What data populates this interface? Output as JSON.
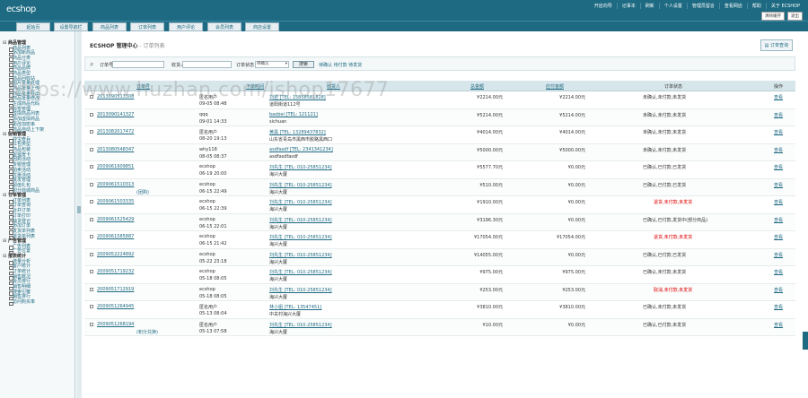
{
  "app": {
    "logo": "ecshop"
  },
  "top": {
    "links": [
      "开店向导",
      "记事本",
      "刷新",
      "个人设置",
      "管理员留言",
      "查看网店",
      "帮助",
      "关于 ECSHOP"
    ],
    "buttons": [
      "清除缓存",
      "退出"
    ]
  },
  "tabs": [
    "起始页",
    "设置导航栏",
    "商品列表",
    "订单列表",
    "用户评论",
    "会员列表",
    "商店设置"
  ],
  "sidebar": [
    {
      "group": "商品管理",
      "items": [
        "商品列表",
        "添加新商品",
        "商品分类",
        "用户评论",
        "商品品牌",
        "商品类型",
        "商品回收站",
        "图片批量处理",
        "商品批量上传",
        "商品批量导出",
        "商品批量修改",
        "生成商品代码",
        "标签管理",
        "虚拟商品列表",
        "添加虚拟商品",
        "更改加密串",
        "商品自动上下架"
      ]
    },
    {
      "group": "促销管理",
      "items": [
        "夺宝奇兵",
        "红包类型",
        "商品包装",
        "祝福贺卡",
        "团购活动",
        "专题管理",
        "拍卖活动",
        "优惠活动",
        "批发管理",
        "超值礼包",
        "积分商城商品"
      ]
    },
    {
      "group": "订单管理",
      "items": [
        "订单列表",
        "订单查询",
        "合并订单",
        "订单打印",
        "缺货登记",
        "添加订单",
        "发货单列表",
        "退货单列表"
      ]
    },
    {
      "group": "广告管理",
      "items": [
        "广告列表",
        "广告位置"
      ]
    },
    {
      "group": "报表统计",
      "items": [
        "流量分析",
        "客户统计",
        "订单统计",
        "销售概况",
        "会员排行",
        "销售明细",
        "搜索引擎",
        "销售排行",
        "访问购买率"
      ]
    }
  ],
  "page": {
    "title": "ECSHOP 管理中心",
    "subtitle": " - 订单列表",
    "query_button": "订单查询"
  },
  "search": {
    "sn_label": "订单号",
    "consignee_label": "收货人",
    "status_label": "订单状态",
    "status_value": "待确认",
    "button": "搜索",
    "quick_links": "待确认 待付款 待发货"
  },
  "table": {
    "headers": {
      "sn": "订单号",
      "time": "下单时间",
      "consignee": "收货人",
      "amount": "总金额",
      "payable": "应付金额",
      "status": "订单状态",
      "action": "操作"
    },
    "rows": [
      {
        "sn": "2013090513308",
        "buyer": "匿名用户",
        "time": "09-05 08:48",
        "consignee": "刘岩 [TEL: 15858581828]",
        "address": "道阳街道112号",
        "amount": "¥2214.00元",
        "payable": "¥2214.00元",
        "status": "未确认,未付款,未发货",
        "action": "查看",
        "tag": ""
      },
      {
        "sn": "2013090141327",
        "buyer": "qqq",
        "time": "09-01 14:33",
        "consignee": "baobei [TEL: 121121]",
        "address": "sichuan",
        "amount": "¥5214.00元",
        "payable": "¥5214.00元",
        "status": "未确认,未付款,未发货",
        "action": "查看",
        "tag": ""
      },
      {
        "sn": "2013082017472",
        "buyer": "匿名用户",
        "time": "08-20 19:13",
        "consignee": "黄黑 [TEL: 13289437832]",
        "address": "山东省青岛市黑西市胶路黑西口",
        "amount": "¥4014.00元",
        "payable": "¥4014.00元",
        "status": "未确认,未付款,未发货",
        "action": "查看",
        "tag": ""
      },
      {
        "sn": "2013080548347",
        "buyer": "why118",
        "time": "08-05 08:37",
        "consignee": "asdfasdf [TEL: 2341341234]",
        "address": "asdfasdfasdf",
        "amount": "¥5000.00元",
        "payable": "¥5000.00元",
        "status": "未确认,未付款,未发货",
        "action": "查看",
        "tag": ""
      },
      {
        "sn": "2009061909851",
        "buyer": "ecshop",
        "time": "06-19 20:00",
        "consignee": "刘先生 [TEL: 010-25851234]",
        "address": "海兴大厦",
        "amount": "¥5577.70元",
        "payable": "¥0.00元",
        "status": "已确认,已付款,已发货",
        "action": "查看",
        "tag": ""
      },
      {
        "sn": "2009061510313",
        "buyer": "ecshop",
        "time": "06-15 22:49",
        "consignee": "刘先生 [TEL: 010-25851234]",
        "address": "海兴大厦",
        "amount": "¥510.00元",
        "payable": "¥0.00元",
        "status": "已确认,已付款,已发货",
        "action": "查看",
        "tag": "(团购)"
      },
      {
        "sn": "2009061503335",
        "buyer": "ecshop",
        "time": "06-15 22:39",
        "consignee": "刘先生 [TEL: 010-25851234]",
        "address": "海兴大厦",
        "amount": "¥1910.00元",
        "payable": "¥0.00元",
        "status": "退货,未付款,未发货",
        "action": "查看",
        "tag": ""
      },
      {
        "sn": "2009061525429",
        "buyer": "ecshop",
        "time": "06-15 22:01",
        "consignee": "刘先生 [TEL: 010-25851234]",
        "address": "海兴大厦",
        "amount": "¥3196.30元",
        "payable": "¥0.00元",
        "status": "已确认,已付款,发货中(部分商品)",
        "action": "查看",
        "tag": ""
      },
      {
        "sn": "2009061585887",
        "buyer": "ecshop",
        "time": "06-15 21:42",
        "consignee": "刘先生 [TEL: 010-25851234]",
        "address": "海兴大厦",
        "amount": "¥17054.00元",
        "payable": "¥17054.00元",
        "status": "退货,未付款,未发货",
        "action": "查看",
        "tag": ""
      },
      {
        "sn": "2009052224892",
        "buyer": "ecshop",
        "time": "05-22 23:18",
        "consignee": "刘先生 [TEL: 010-25851234]",
        "address": "海兴大厦",
        "amount": "¥14055.00元",
        "payable": "¥0.00元",
        "status": "已确认,已付款,已发货",
        "action": "查看",
        "tag": ""
      },
      {
        "sn": "2009051719232",
        "buyer": "ecshop",
        "time": "05-18 08:05",
        "consignee": "刘先生 [TEL: 010-25851234]",
        "address": "海兴大厦",
        "amount": "¥975.00元",
        "payable": "¥975.00元",
        "status": "已确认,未付款,未发货",
        "action": "查看",
        "tag": ""
      },
      {
        "sn": "2009051712919",
        "buyer": "ecshop",
        "time": "05-18 08:05",
        "consignee": "刘先生 [TEL: 010-25851234]",
        "address": "海兴大厦",
        "amount": "¥253.00元",
        "payable": "¥253.00元",
        "status": "取消,未付款,未发货",
        "action": "查看",
        "tag": ""
      },
      {
        "sn": "2009051264945",
        "buyer": "匿名用户",
        "time": "05-13 08:04",
        "consignee": "林小姐 [TEL: 13547451]",
        "address": "中关村海兴大厦",
        "amount": "¥3810.00元",
        "payable": "¥3810.00元",
        "status": "已确认,未付款,未发货",
        "action": "查看",
        "tag": ""
      },
      {
        "sn": "2009051268194",
        "buyer": "匿名用户",
        "time": "05-13 07:58",
        "consignee": "刘先生 [TEL: 010-25851234]",
        "address": "海兴大厦",
        "amount": "¥10.00元",
        "payable": "¥0.00元",
        "status": "已确认,已付款,未发货",
        "action": "查看",
        "tag": "(积分兑换)"
      }
    ]
  },
  "watermark": "https://www.huzhan.com/ishop17677"
}
